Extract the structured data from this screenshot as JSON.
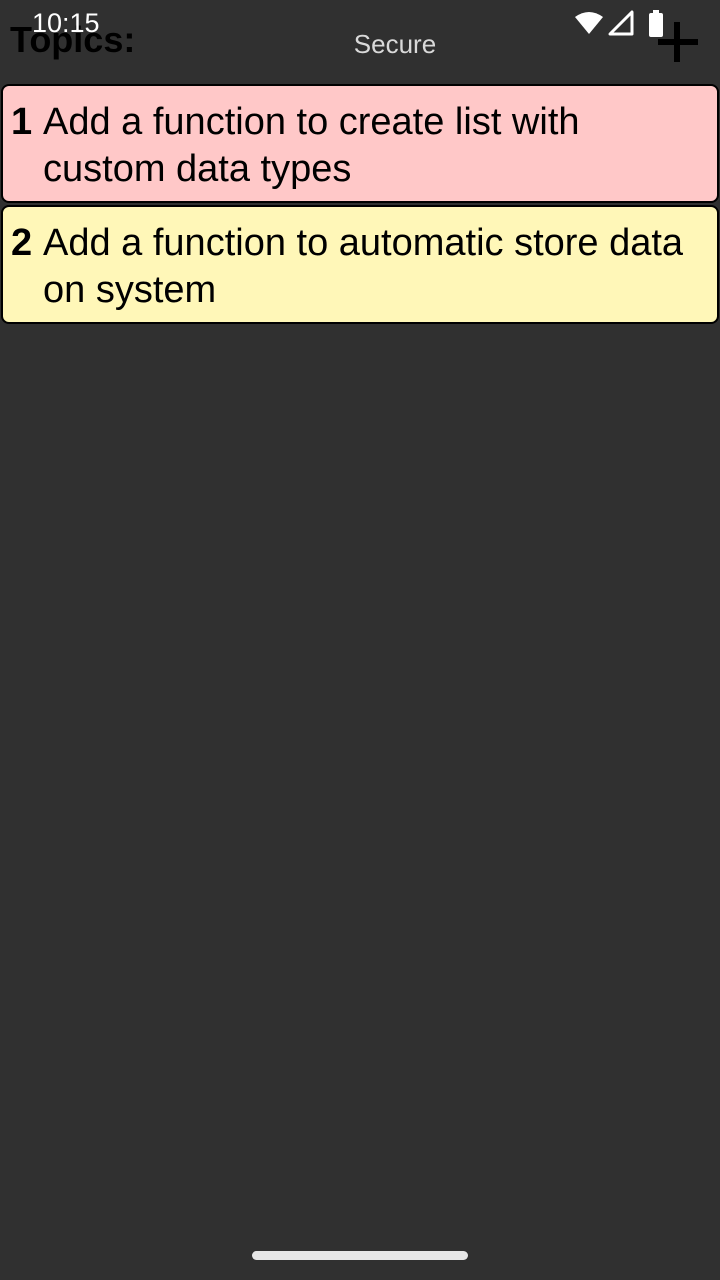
{
  "status_bar": {
    "time": "10:15",
    "wifi_icon": "wifi-icon",
    "signal_icon": "cell-signal-icon",
    "battery_icon": "battery-icon"
  },
  "header": {
    "title": "Topics:",
    "secure_label": "Secure",
    "add_icon": "plus-icon"
  },
  "topics": [
    {
      "number": "1",
      "text": "Add a function to create list with custom data types",
      "color": "#ffc8c8"
    },
    {
      "number": "2",
      "text": "Add a function to automatic store data on system",
      "color": "#fff7b8"
    }
  ],
  "colors": {
    "background": "#303030"
  }
}
